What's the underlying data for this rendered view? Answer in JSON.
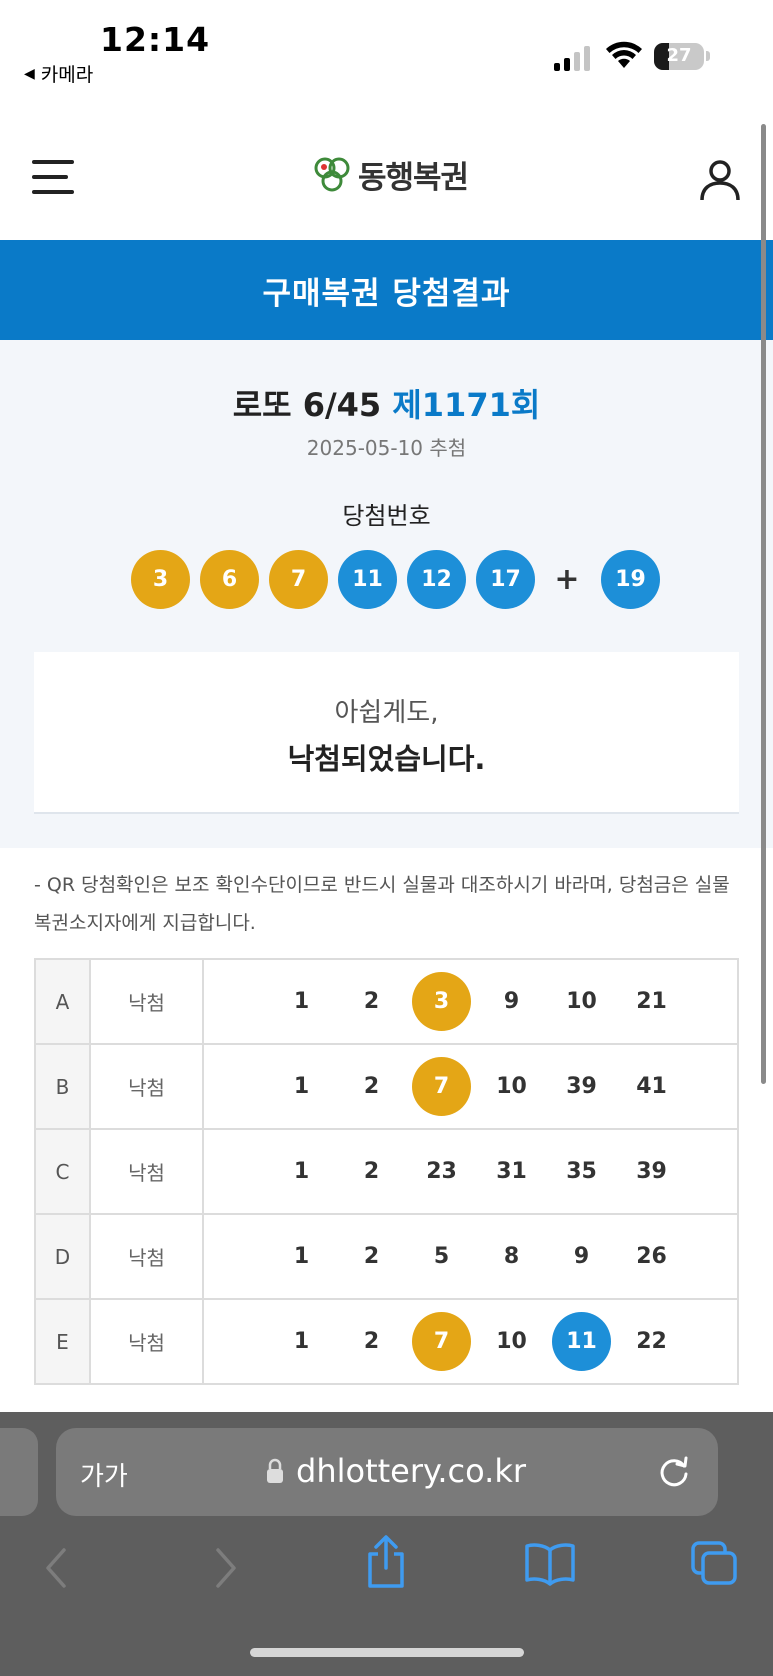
{
  "status_bar": {
    "time": "12:14",
    "back_app": "카메라",
    "battery": "27"
  },
  "header": {
    "logo_text": "동행복권"
  },
  "title_bar": {
    "title": "구매복권 당첨결과"
  },
  "draw": {
    "game_name": "로또 6/45",
    "round": "제1171회",
    "date": "2025-05-10 추첨",
    "winning_label": "당첨번호",
    "numbers": [
      "3",
      "6",
      "7",
      "11",
      "12",
      "17"
    ],
    "plus": "+",
    "bonus": "19"
  },
  "result": {
    "sorry": "아쉽게도,",
    "message": "낙첨되었습니다."
  },
  "notice": {
    "text": "- QR 당첨확인은 보조 확인수단이므로 반드시 실물과 대조하시기 바라며, 당첨금은 실물 복권소지자에게 지급합니다."
  },
  "ticket": [
    {
      "game": "A",
      "status": "낙첨",
      "numbers": [
        "1",
        "2",
        "3",
        "9",
        "10",
        "21"
      ]
    },
    {
      "game": "B",
      "status": "낙첨",
      "numbers": [
        "1",
        "2",
        "7",
        "10",
        "39",
        "41"
      ]
    },
    {
      "game": "C",
      "status": "낙첨",
      "numbers": [
        "1",
        "2",
        "23",
        "31",
        "35",
        "39"
      ]
    },
    {
      "game": "D",
      "status": "낙첨",
      "numbers": [
        "1",
        "2",
        "5",
        "8",
        "9",
        "26"
      ]
    },
    {
      "game": "E",
      "status": "낙첨",
      "numbers": [
        "1",
        "2",
        "7",
        "10",
        "11",
        "22"
      ]
    }
  ],
  "safari": {
    "text_size_label": "가가",
    "url": "dhlottery.co.kr"
  },
  "colors": {
    "brand_blue": "#0a7ac8",
    "ball_yellow": "#e4a616",
    "ball_blue": "#1d8fd8"
  }
}
